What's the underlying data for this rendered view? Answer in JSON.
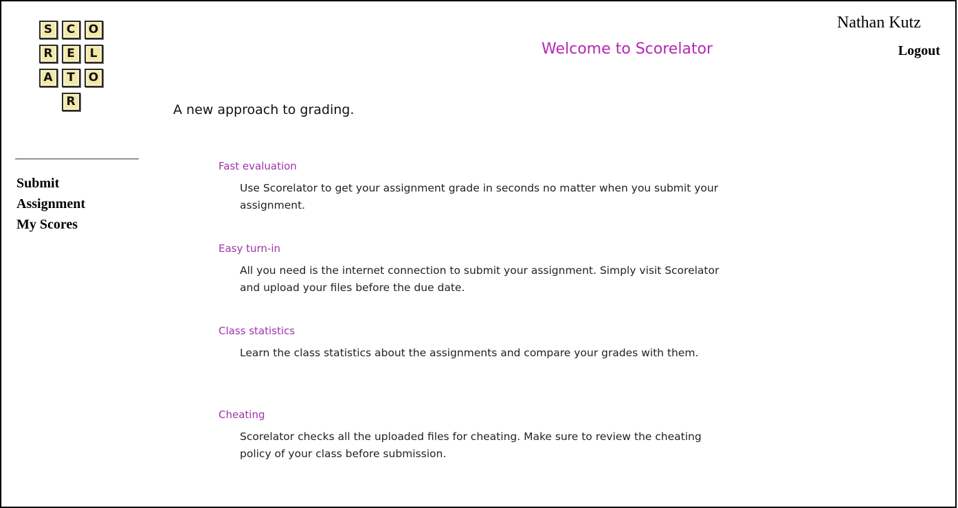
{
  "header": {
    "user_name": "Nathan Kutz",
    "logout_label": "Logout",
    "welcome_title": "Welcome to Scorelator"
  },
  "logo": {
    "rows": [
      [
        "S",
        "C",
        "O"
      ],
      [
        "R",
        "E",
        "L"
      ],
      [
        "A",
        "T",
        "O"
      ],
      [
        "R"
      ]
    ]
  },
  "sidebar": {
    "items": [
      {
        "label": "Submit Assignment"
      },
      {
        "label": "My Scores"
      }
    ]
  },
  "main": {
    "tagline": "A new approach to grading.",
    "features": [
      {
        "title": "Fast evaluation",
        "description": "Use Scorelator to get your assignment grade in seconds no matter when you submit your assignment."
      },
      {
        "title": "Easy turn-in",
        "description": "All you need is the internet connection to submit your assignment. Simply visit Scorelator and upload your files before the due date."
      },
      {
        "title": "Class statistics",
        "description": "Learn the class statistics about the assignments and compare your grades with them."
      },
      {
        "title": "Cheating",
        "description": "Scorelator checks all the uploaded files for cheating. Make sure to review the cheating policy of your class before submission."
      }
    ]
  },
  "colors": {
    "accent": "#b427b4",
    "feature_title": "#a033a8",
    "tile_fill": "#f2e8a8"
  }
}
